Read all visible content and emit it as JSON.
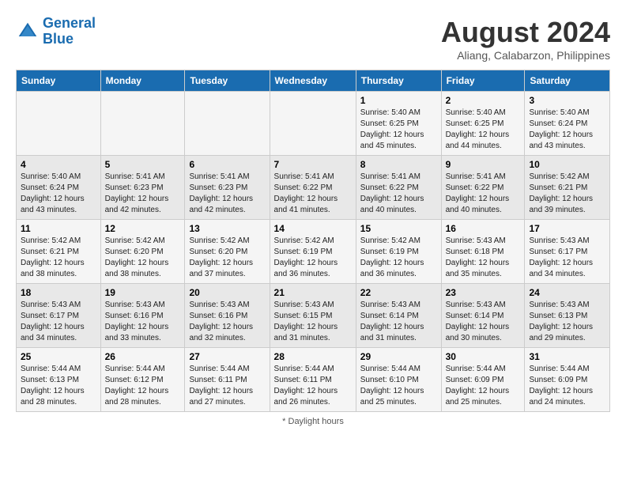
{
  "header": {
    "logo_line1": "General",
    "logo_line2": "Blue",
    "month_year": "August 2024",
    "location": "Aliang, Calabarzon, Philippines"
  },
  "days_of_week": [
    "Sunday",
    "Monday",
    "Tuesday",
    "Wednesday",
    "Thursday",
    "Friday",
    "Saturday"
  ],
  "weeks": [
    [
      {
        "day": "",
        "sunrise": "",
        "sunset": "",
        "daylight": ""
      },
      {
        "day": "",
        "sunrise": "",
        "sunset": "",
        "daylight": ""
      },
      {
        "day": "",
        "sunrise": "",
        "sunset": "",
        "daylight": ""
      },
      {
        "day": "",
        "sunrise": "",
        "sunset": "",
        "daylight": ""
      },
      {
        "day": "1",
        "sunrise": "Sunrise: 5:40 AM",
        "sunset": "Sunset: 6:25 PM",
        "daylight": "Daylight: 12 hours and 45 minutes."
      },
      {
        "day": "2",
        "sunrise": "Sunrise: 5:40 AM",
        "sunset": "Sunset: 6:25 PM",
        "daylight": "Daylight: 12 hours and 44 minutes."
      },
      {
        "day": "3",
        "sunrise": "Sunrise: 5:40 AM",
        "sunset": "Sunset: 6:24 PM",
        "daylight": "Daylight: 12 hours and 43 minutes."
      }
    ],
    [
      {
        "day": "4",
        "sunrise": "Sunrise: 5:40 AM",
        "sunset": "Sunset: 6:24 PM",
        "daylight": "Daylight: 12 hours and 43 minutes."
      },
      {
        "day": "5",
        "sunrise": "Sunrise: 5:41 AM",
        "sunset": "Sunset: 6:23 PM",
        "daylight": "Daylight: 12 hours and 42 minutes."
      },
      {
        "day": "6",
        "sunrise": "Sunrise: 5:41 AM",
        "sunset": "Sunset: 6:23 PM",
        "daylight": "Daylight: 12 hours and 42 minutes."
      },
      {
        "day": "7",
        "sunrise": "Sunrise: 5:41 AM",
        "sunset": "Sunset: 6:22 PM",
        "daylight": "Daylight: 12 hours and 41 minutes."
      },
      {
        "day": "8",
        "sunrise": "Sunrise: 5:41 AM",
        "sunset": "Sunset: 6:22 PM",
        "daylight": "Daylight: 12 hours and 40 minutes."
      },
      {
        "day": "9",
        "sunrise": "Sunrise: 5:41 AM",
        "sunset": "Sunset: 6:22 PM",
        "daylight": "Daylight: 12 hours and 40 minutes."
      },
      {
        "day": "10",
        "sunrise": "Sunrise: 5:42 AM",
        "sunset": "Sunset: 6:21 PM",
        "daylight": "Daylight: 12 hours and 39 minutes."
      }
    ],
    [
      {
        "day": "11",
        "sunrise": "Sunrise: 5:42 AM",
        "sunset": "Sunset: 6:21 PM",
        "daylight": "Daylight: 12 hours and 38 minutes."
      },
      {
        "day": "12",
        "sunrise": "Sunrise: 5:42 AM",
        "sunset": "Sunset: 6:20 PM",
        "daylight": "Daylight: 12 hours and 38 minutes."
      },
      {
        "day": "13",
        "sunrise": "Sunrise: 5:42 AM",
        "sunset": "Sunset: 6:20 PM",
        "daylight": "Daylight: 12 hours and 37 minutes."
      },
      {
        "day": "14",
        "sunrise": "Sunrise: 5:42 AM",
        "sunset": "Sunset: 6:19 PM",
        "daylight": "Daylight: 12 hours and 36 minutes."
      },
      {
        "day": "15",
        "sunrise": "Sunrise: 5:42 AM",
        "sunset": "Sunset: 6:19 PM",
        "daylight": "Daylight: 12 hours and 36 minutes."
      },
      {
        "day": "16",
        "sunrise": "Sunrise: 5:43 AM",
        "sunset": "Sunset: 6:18 PM",
        "daylight": "Daylight: 12 hours and 35 minutes."
      },
      {
        "day": "17",
        "sunrise": "Sunrise: 5:43 AM",
        "sunset": "Sunset: 6:17 PM",
        "daylight": "Daylight: 12 hours and 34 minutes."
      }
    ],
    [
      {
        "day": "18",
        "sunrise": "Sunrise: 5:43 AM",
        "sunset": "Sunset: 6:17 PM",
        "daylight": "Daylight: 12 hours and 34 minutes."
      },
      {
        "day": "19",
        "sunrise": "Sunrise: 5:43 AM",
        "sunset": "Sunset: 6:16 PM",
        "daylight": "Daylight: 12 hours and 33 minutes."
      },
      {
        "day": "20",
        "sunrise": "Sunrise: 5:43 AM",
        "sunset": "Sunset: 6:16 PM",
        "daylight": "Daylight: 12 hours and 32 minutes."
      },
      {
        "day": "21",
        "sunrise": "Sunrise: 5:43 AM",
        "sunset": "Sunset: 6:15 PM",
        "daylight": "Daylight: 12 hours and 31 minutes."
      },
      {
        "day": "22",
        "sunrise": "Sunrise: 5:43 AM",
        "sunset": "Sunset: 6:14 PM",
        "daylight": "Daylight: 12 hours and 31 minutes."
      },
      {
        "day": "23",
        "sunrise": "Sunrise: 5:43 AM",
        "sunset": "Sunset: 6:14 PM",
        "daylight": "Daylight: 12 hours and 30 minutes."
      },
      {
        "day": "24",
        "sunrise": "Sunrise: 5:43 AM",
        "sunset": "Sunset: 6:13 PM",
        "daylight": "Daylight: 12 hours and 29 minutes."
      }
    ],
    [
      {
        "day": "25",
        "sunrise": "Sunrise: 5:44 AM",
        "sunset": "Sunset: 6:13 PM",
        "daylight": "Daylight: 12 hours and 28 minutes."
      },
      {
        "day": "26",
        "sunrise": "Sunrise: 5:44 AM",
        "sunset": "Sunset: 6:12 PM",
        "daylight": "Daylight: 12 hours and 28 minutes."
      },
      {
        "day": "27",
        "sunrise": "Sunrise: 5:44 AM",
        "sunset": "Sunset: 6:11 PM",
        "daylight": "Daylight: 12 hours and 27 minutes."
      },
      {
        "day": "28",
        "sunrise": "Sunrise: 5:44 AM",
        "sunset": "Sunset: 6:11 PM",
        "daylight": "Daylight: 12 hours and 26 minutes."
      },
      {
        "day": "29",
        "sunrise": "Sunrise: 5:44 AM",
        "sunset": "Sunset: 6:10 PM",
        "daylight": "Daylight: 12 hours and 25 minutes."
      },
      {
        "day": "30",
        "sunrise": "Sunrise: 5:44 AM",
        "sunset": "Sunset: 6:09 PM",
        "daylight": "Daylight: 12 hours and 25 minutes."
      },
      {
        "day": "31",
        "sunrise": "Sunrise: 5:44 AM",
        "sunset": "Sunset: 6:09 PM",
        "daylight": "Daylight: 12 hours and 24 minutes."
      }
    ]
  ],
  "footer": {
    "note": "Daylight hours"
  }
}
